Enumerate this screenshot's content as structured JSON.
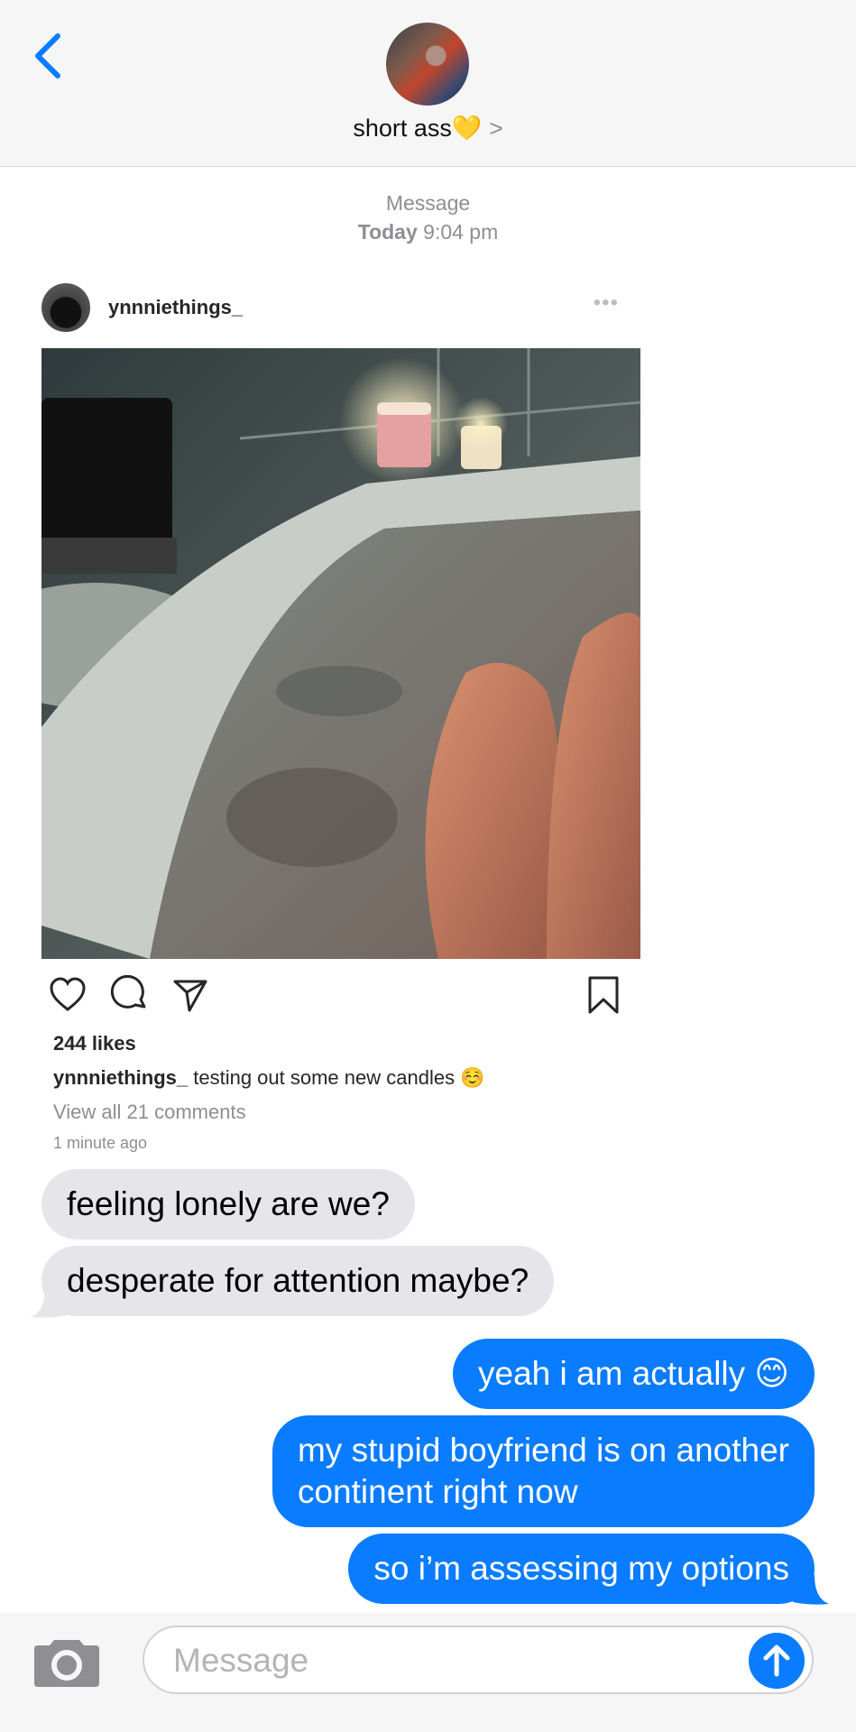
{
  "header": {
    "contact_name": "short ass💛",
    "chevron": ">"
  },
  "timestamp": {
    "line1": "Message",
    "day": "Today",
    "time": "9:04 pm"
  },
  "post": {
    "username": "ynnniethings_",
    "more": "•••",
    "likes": "244 likes",
    "caption_user": "ynnniethings_",
    "caption_text": " testing out some new candles ☺️",
    "view_all": "View all 21 comments",
    "time_ago": "1 minute ago"
  },
  "messages": {
    "incoming": [
      "feeling lonely are we?",
      "desperate for attention maybe?"
    ],
    "outgoing": [
      "yeah i am actually 😊",
      "my stupid boyfriend is on another",
      "continent right now",
      "so i’m assessing my options"
    ]
  },
  "composer": {
    "placeholder": "Message"
  },
  "colors": {
    "accent": "#0a7cff",
    "incoming_bubble": "#e5e5ea",
    "header_bg": "#f6f6f6"
  }
}
